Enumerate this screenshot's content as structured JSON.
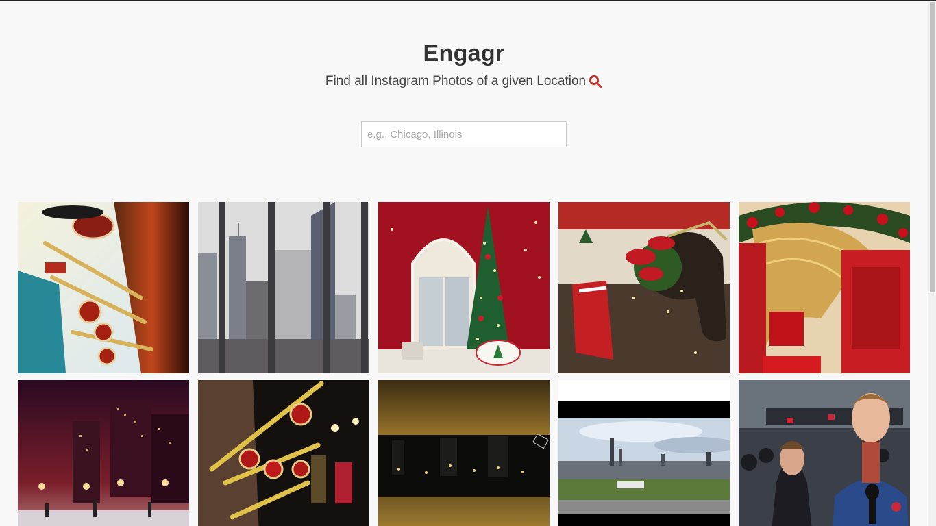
{
  "header": {
    "title": "Engagr",
    "subtitle": "Find all Instagram Photos of a given Location"
  },
  "search": {
    "placeholder": "e.g., Chicago, Illinois",
    "value": ""
  },
  "colors": {
    "accent": "#c0392b",
    "background": "#f8f8f8",
    "text": "#333333"
  },
  "icons": {
    "subtitle_icon": "search-icon"
  },
  "photos": [
    "photo-macys-trumpets-day",
    "photo-chicago-skyline-gray",
    "photo-christmas-tree-window",
    "photo-horse-poinsettia",
    "photo-red-gold-display",
    "photo-ice-rink-night",
    "photo-macys-trumpets-night",
    "photo-skyline-night-blur",
    "photo-skyline-panorama",
    "photo-premiere-crowd"
  ]
}
